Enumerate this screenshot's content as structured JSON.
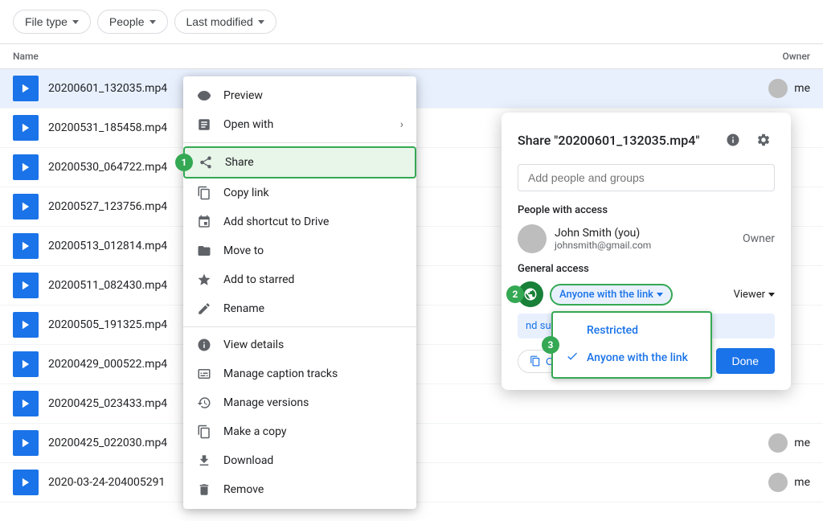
{
  "filters": {
    "file_type": "File type",
    "people": "People",
    "last_modified": "Last modified"
  },
  "file_list": {
    "col_name": "Name",
    "col_owner": "Owner",
    "files": [
      {
        "name": "20200601_132035.mp4",
        "owner": "me",
        "selected": true
      },
      {
        "name": "20200531_185458.mp4",
        "owner": "",
        "selected": false
      },
      {
        "name": "20200530_064722.mp4",
        "owner": "",
        "selected": false
      },
      {
        "name": "20200527_123756.mp4",
        "owner": "",
        "selected": false
      },
      {
        "name": "20200513_012814.mp4",
        "owner": "",
        "selected": false
      },
      {
        "name": "20200511_082430.mp4",
        "owner": "",
        "selected": false
      },
      {
        "name": "20200505_191325.mp4",
        "owner": "",
        "selected": false
      },
      {
        "name": "20200429_000522.mp4",
        "owner": "",
        "selected": false
      },
      {
        "name": "20200425_023433.mp4",
        "owner": "",
        "selected": false
      },
      {
        "name": "20200425_022030.mp4",
        "owner": "me",
        "selected": false
      },
      {
        "name": "2020-03-24-204005291",
        "owner": "me",
        "selected": false
      }
    ]
  },
  "context_menu": {
    "items": [
      {
        "id": "preview",
        "label": "Preview",
        "has_arrow": false
      },
      {
        "id": "open-with",
        "label": "Open with",
        "has_arrow": true
      },
      {
        "id": "share",
        "label": "Share",
        "has_arrow": false,
        "highlighted": true,
        "step": "1"
      },
      {
        "id": "copy-link",
        "label": "Copy link",
        "has_arrow": false
      },
      {
        "id": "add-shortcut",
        "label": "Add shortcut to Drive",
        "has_arrow": false
      },
      {
        "id": "move-to",
        "label": "Move to",
        "has_arrow": false
      },
      {
        "id": "add-starred",
        "label": "Add to starred",
        "has_arrow": false
      },
      {
        "id": "rename",
        "label": "Rename",
        "has_arrow": false
      },
      {
        "id": "view-details",
        "label": "View details",
        "has_arrow": false
      },
      {
        "id": "manage-captions",
        "label": "Manage caption tracks",
        "has_arrow": false
      },
      {
        "id": "manage-versions",
        "label": "Manage versions",
        "has_arrow": false
      },
      {
        "id": "make-copy",
        "label": "Make a copy",
        "has_arrow": false
      },
      {
        "id": "download",
        "label": "Download",
        "has_arrow": false
      },
      {
        "id": "remove",
        "label": "Remove",
        "has_arrow": false
      }
    ]
  },
  "share_dialog": {
    "title_prefix": "Share ",
    "file_name": "\"20200601_132035.mp4\"",
    "add_people_placeholder": "Add people and groups",
    "people_access_label": "People with access",
    "person": {
      "name": "John Smith (you)",
      "email": "johnsmith@gmail.com",
      "role": "Owner"
    },
    "general_access_label": "General access",
    "access_option": "Anyone with the link",
    "viewer_label": "Viewer",
    "suggestions_text": "nd suggestions",
    "copy_link_label": "Copy link",
    "done_label": "Done",
    "step2": "2",
    "access_popup": {
      "step": "3",
      "items": [
        {
          "id": "restricted",
          "label": "Restricted",
          "checked": false
        },
        {
          "id": "anyone-link",
          "label": "Anyone with the link",
          "checked": true
        }
      ]
    }
  }
}
